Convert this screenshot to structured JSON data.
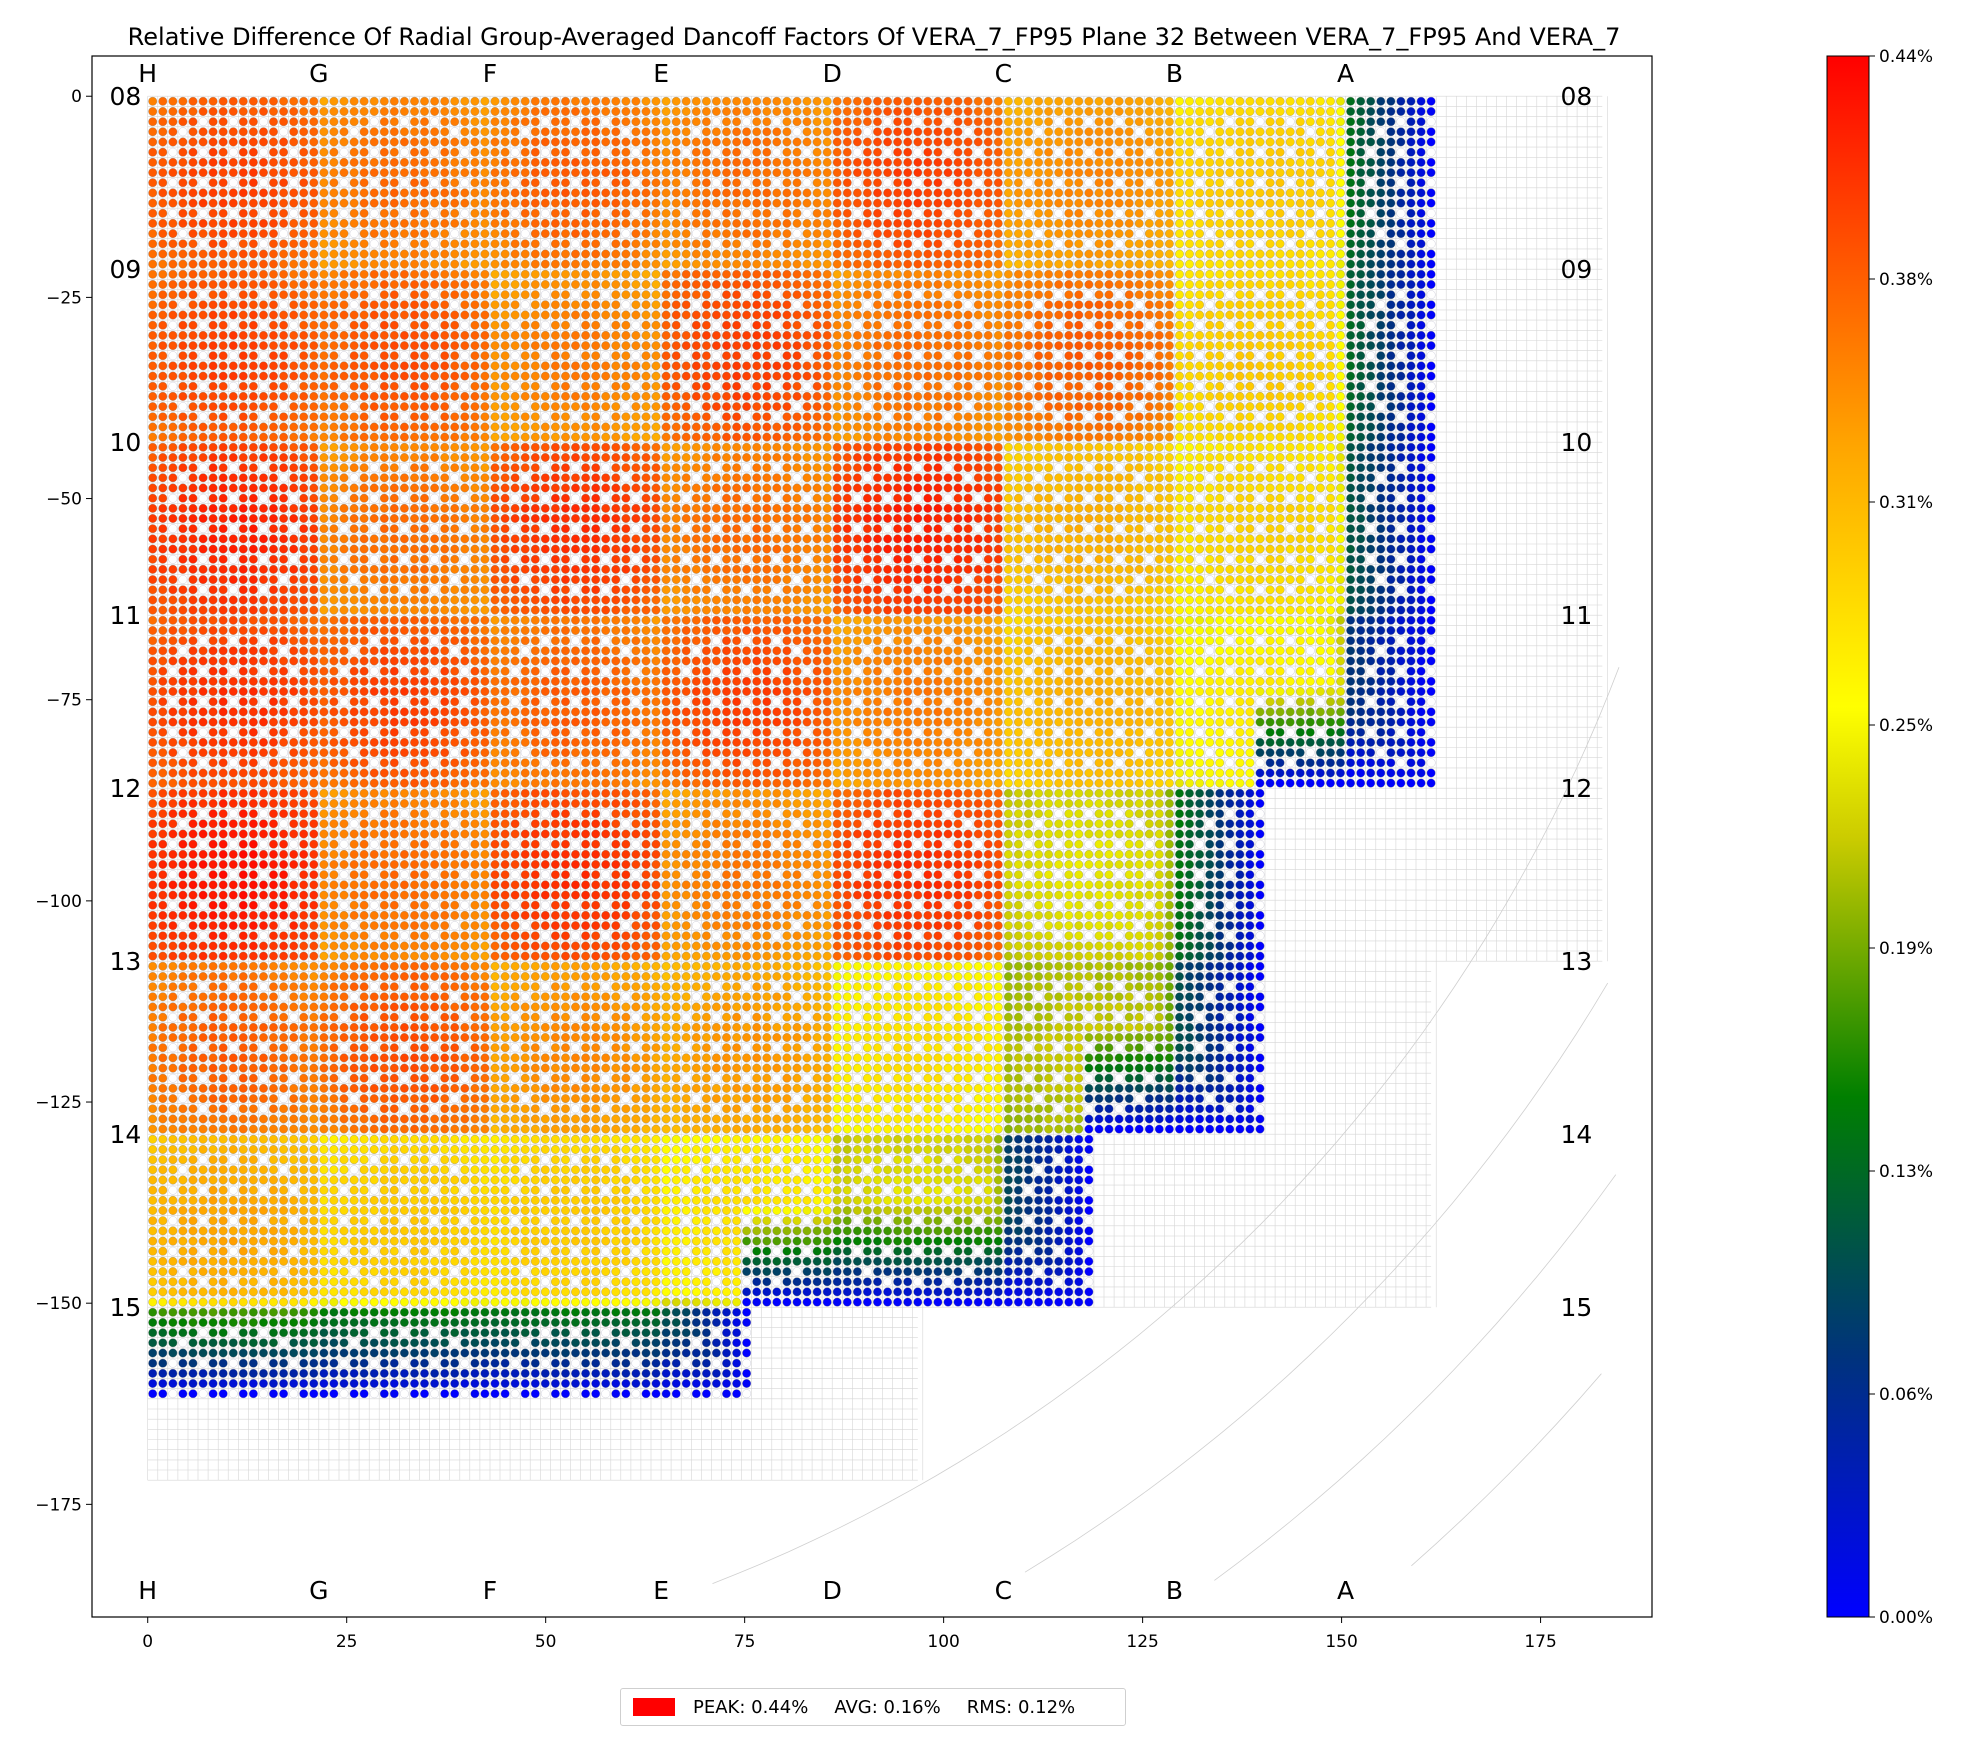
{
  "chart_data": {
    "type": "heatmap",
    "title": "Relative Difference Of Radial Group-Averaged Dancoff Factors Of VERA_7_FP95 Plane 32 Between VERA_7_FP95 And VERA_7",
    "xlabel": "",
    "ylabel": "",
    "xlim": [
      -7,
      189
    ],
    "ylim": [
      -189,
      5
    ],
    "x_ticks": [
      "0",
      "25",
      "50",
      "75",
      "100",
      "125",
      "150",
      "175"
    ],
    "y_ticks": [
      "0",
      "−25",
      "−50",
      "−75",
      "−100",
      "−125",
      "−150",
      "−175"
    ],
    "column_labels": [
      "H",
      "G",
      "F",
      "E",
      "D",
      "C",
      "B",
      "A"
    ],
    "row_labels": [
      "08",
      "09",
      "10",
      "11",
      "12",
      "13",
      "14",
      "15"
    ],
    "assembly_pitch": 21.5,
    "pins_per_assembly": 17,
    "core_row_extent_assemblies": [
      7.5,
      7.5,
      7.5,
      7.5,
      6.5,
      6.5,
      5.5,
      3.5
    ],
    "quadrant_grid_extent_assemblies": [
      8.5,
      8.5,
      8.5,
      8.5,
      8.5,
      7.5,
      7.5,
      4.5
    ],
    "value_range_percent": [
      0.0,
      0.44
    ],
    "assembly_peak_percent": [
      [
        0.4,
        0.37,
        0.38,
        0.37,
        0.4,
        0.35,
        0.3,
        0.17
      ],
      [
        0.4,
        0.39,
        0.36,
        0.4,
        0.37,
        0.38,
        0.3,
        0.16
      ],
      [
        0.42,
        0.37,
        0.41,
        0.37,
        0.42,
        0.32,
        0.29,
        0.14
      ],
      [
        0.41,
        0.4,
        0.38,
        0.4,
        0.36,
        0.32,
        0.27,
        0.1
      ],
      [
        0.43,
        0.37,
        0.41,
        0.36,
        0.41,
        0.24,
        0.18
      ],
      [
        0.38,
        0.39,
        0.35,
        0.34,
        0.28,
        0.22,
        0.13
      ],
      [
        0.33,
        0.3,
        0.3,
        0.28,
        0.24,
        0.12
      ],
      [
        0.22,
        0.19,
        0.18,
        0.15
      ]
    ],
    "colorbar": {
      "ticks": [
        "0.00%",
        "0.06%",
        "0.13%",
        "0.19%",
        "0.25%",
        "0.31%",
        "0.38%",
        "0.44%"
      ],
      "colors": [
        "#0000ff",
        "#00337c",
        "#007f00",
        "#cccc00",
        "#ffff00",
        "#ffa500",
        "#ff0000"
      ]
    },
    "legend": {
      "color": "#ff0000",
      "peak": "PEAK: 0.44%",
      "avg": "AVG: 0.16%",
      "rms": "RMS: 0.12%"
    }
  }
}
